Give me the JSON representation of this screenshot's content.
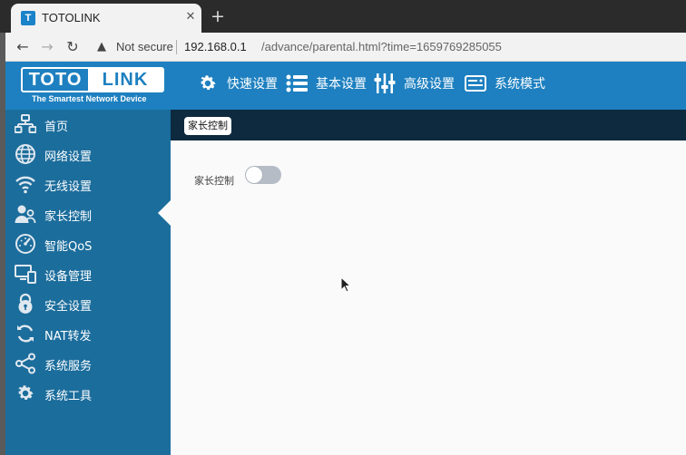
{
  "browser": {
    "tab_title": "TOTOLINK",
    "tab_favicon": "T",
    "close_glyph": "✕",
    "new_tab_glyph": "+",
    "back_glyph": "←",
    "forward_glyph": "→",
    "reload_glyph": "↻",
    "warning_glyph": "▲",
    "not_secure": "Not secure",
    "url_host": "192.168.0.1",
    "url_path": "/advance/parental.html?time=1659769285055"
  },
  "logo": {
    "left": "TOTO",
    "right": "LINK",
    "tagline": "The Smartest Network Device"
  },
  "topnav": [
    {
      "label": "快速设置",
      "icon": "gear-icon"
    },
    {
      "label": "基本设置",
      "icon": "list-icon"
    },
    {
      "label": "高级设置",
      "icon": "sliders-icon"
    },
    {
      "label": "系统模式",
      "icon": "router-icon"
    }
  ],
  "sidebar": {
    "items": [
      {
        "label": "首页",
        "icon": "network-home-icon"
      },
      {
        "label": "网络设置",
        "icon": "globe-icon"
      },
      {
        "label": "无线设置",
        "icon": "wifi-icon"
      },
      {
        "label": "家长控制",
        "icon": "parental-icon"
      },
      {
        "label": "智能QoS",
        "icon": "gauge-icon"
      },
      {
        "label": "设备管理",
        "icon": "devices-icon"
      },
      {
        "label": "安全设置",
        "icon": "lock-icon"
      },
      {
        "label": "NAT转发",
        "icon": "refresh-icon"
      },
      {
        "label": "系统服务",
        "icon": "share-icon"
      },
      {
        "label": "系统工具",
        "icon": "gear-icon"
      }
    ],
    "active_index": 3
  },
  "page": {
    "breadcrumb": "家长控制",
    "toggle_label": "家长控制",
    "toggle_on": false
  },
  "colors": {
    "header": "#1e80c0",
    "sidebar": "#1b6d9c",
    "subheader": "#0d2a3f",
    "toggle_off": "#b5bcc6"
  }
}
